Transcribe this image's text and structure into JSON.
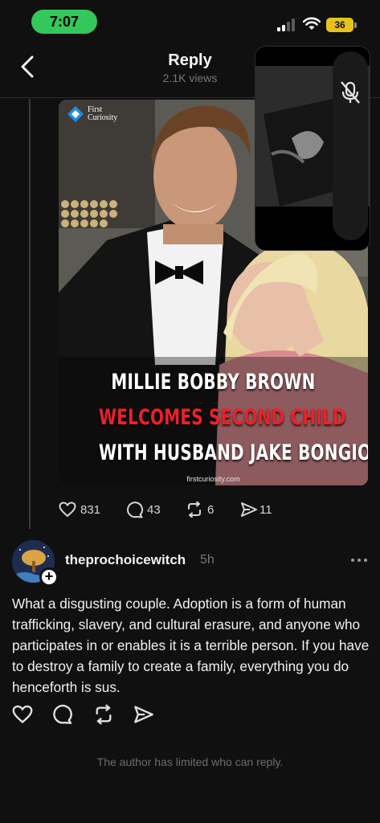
{
  "status_bar": {
    "time": "7:07",
    "battery": "36"
  },
  "header": {
    "title": "Reply",
    "views": "2.1K views"
  },
  "post_image": {
    "brand_line1": "First",
    "brand_line2": "Curiosity",
    "headline_line1": "MILLIE BOBBY BROWN",
    "headline_line2": "WELCOMES SECOND CHILD",
    "headline_line3": "WITH HUSBAND JAKE BONGIOVI",
    "credit": "firstcuriosity.com",
    "colors": {
      "headline_white": "#ffffff",
      "headline_red": "#ee2026"
    }
  },
  "post_actions": {
    "likes": "831",
    "comments": "43",
    "reposts": "6",
    "shares": "11"
  },
  "reply": {
    "username": "theprochoicewitch",
    "time": "5h",
    "text": "What a disgusting couple. Adoption is a form of human trafficking, slavery, and cultural erasure, and anyone who participates in or enables it is a terrible person. If you have to destroy a family to create a family, everything you do henceforth is sus."
  },
  "footer_note": "The author has limited who can reply.",
  "colors": {
    "background": "#101010",
    "time_pill": "#34c759",
    "battery": "#e7c21c"
  }
}
